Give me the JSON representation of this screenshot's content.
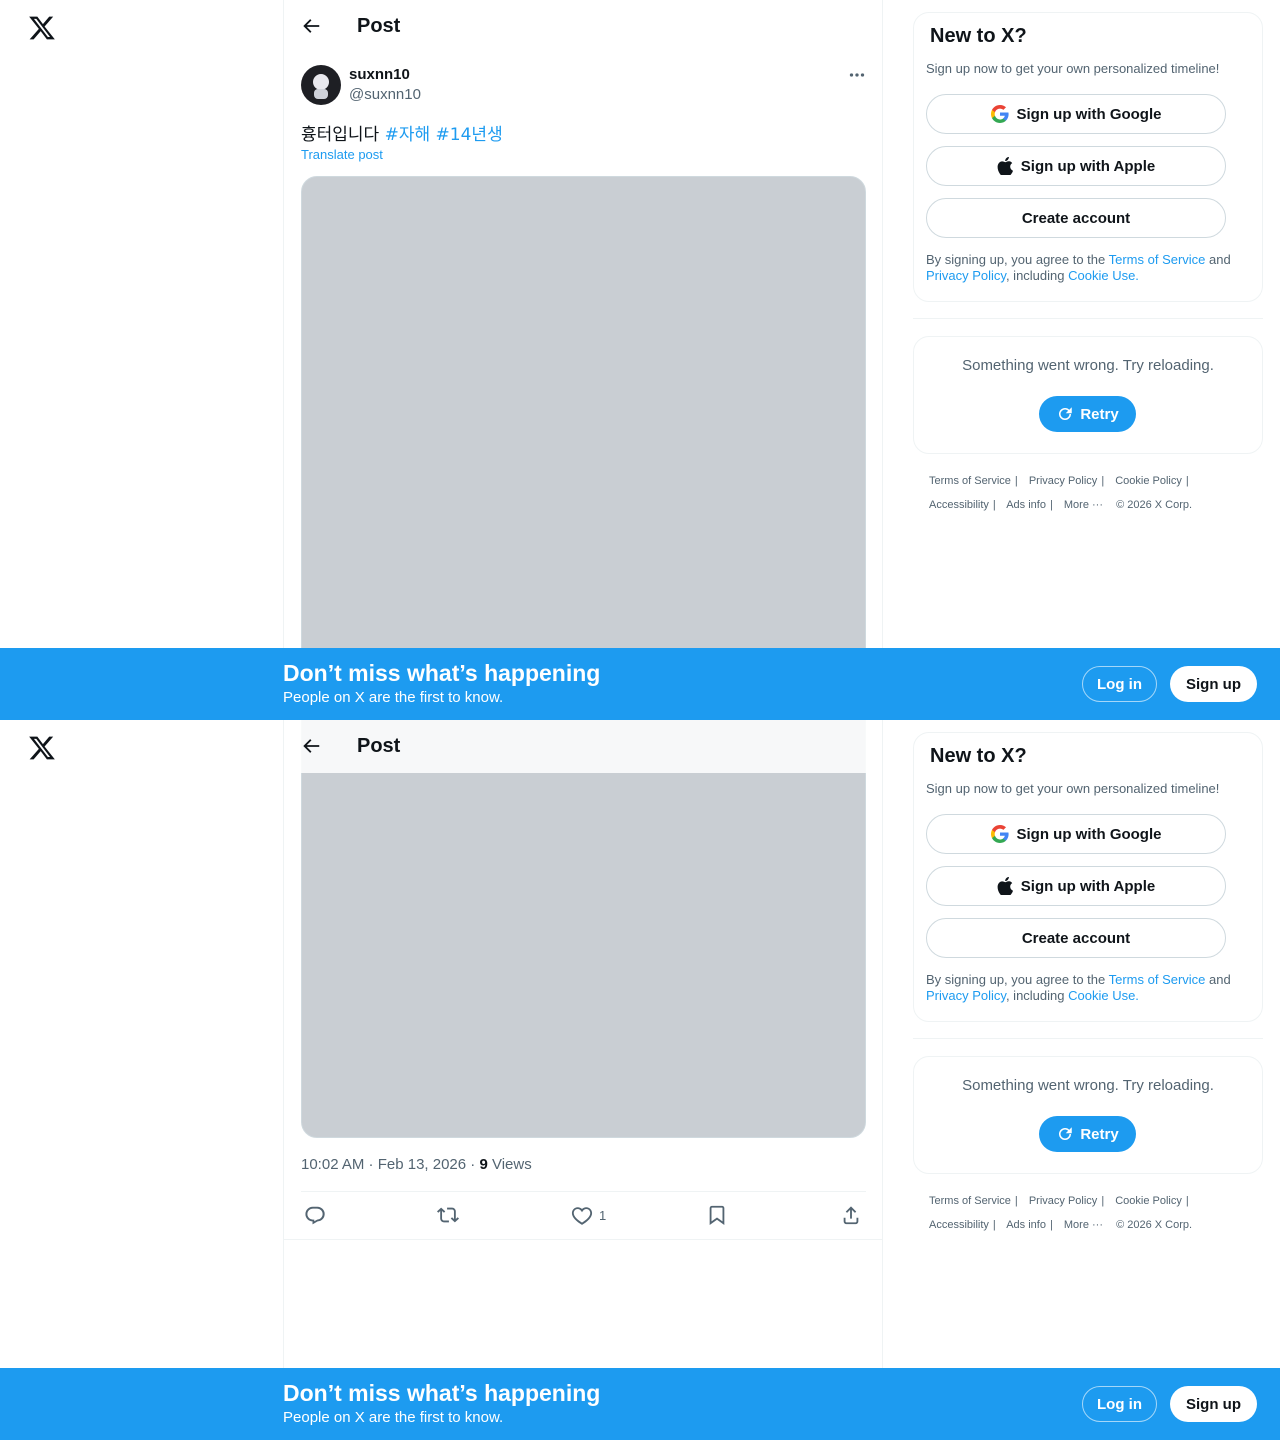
{
  "header": {
    "title": "Post"
  },
  "author": {
    "name": "suxnn10",
    "handle": "@suxnn10"
  },
  "post": {
    "text": "흉터입니다",
    "hashtags": [
      "#자해",
      "#14년생"
    ],
    "translate": "Translate post",
    "time": "10:02 AM · Feb 13, 2026 · ",
    "views_count": "9",
    "views_label": " Views"
  },
  "actions": {
    "likes": "1"
  },
  "signup_card": {
    "title": "New to X?",
    "subtitle": "Sign up now to get your own personalized timeline!",
    "google": "Sign up with Google",
    "apple": "Sign up with Apple",
    "create": "Create account",
    "legal_pre": "By signing up, you agree to the ",
    "terms": "Terms of Service",
    "and": " and",
    "privacy": "Privacy Policy",
    "including": ", including ",
    "cookie": "Cookie Use."
  },
  "error_card": {
    "message": "Something went wrong. Try reloading.",
    "retry": "Retry"
  },
  "footer": {
    "terms": "Terms of Service",
    "privacy": "Privacy Policy",
    "cookie": "Cookie Policy",
    "accessibility": "Accessibility",
    "ads": "Ads info",
    "more": "More ···",
    "copyright": "© 2026 X Corp."
  },
  "banner": {
    "title": "Don’t miss what’s happening",
    "subtitle": "People on X are the first to know.",
    "login": "Log in",
    "signup": "Sign up"
  },
  "colors": {
    "accent": "#1d9bf0",
    "text": "#0f1419",
    "muted": "#536471"
  }
}
